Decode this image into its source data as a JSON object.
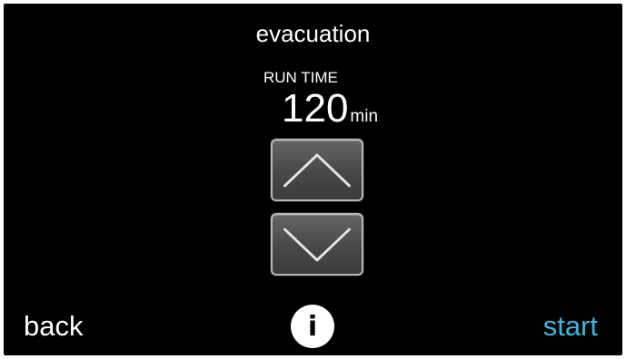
{
  "screen": {
    "title": "evacuation"
  },
  "run_time": {
    "label": "RUN TIME",
    "value": "120",
    "unit": "min"
  },
  "controls": {
    "increase_icon": "chevron-up-icon",
    "decrease_icon": "chevron-down-icon"
  },
  "footer": {
    "back_label": "back",
    "info_label": "i",
    "info_icon": "info-icon",
    "start_label": "start"
  },
  "colors": {
    "background": "#000000",
    "text": "#ffffff",
    "accent": "#3fb6d9"
  }
}
